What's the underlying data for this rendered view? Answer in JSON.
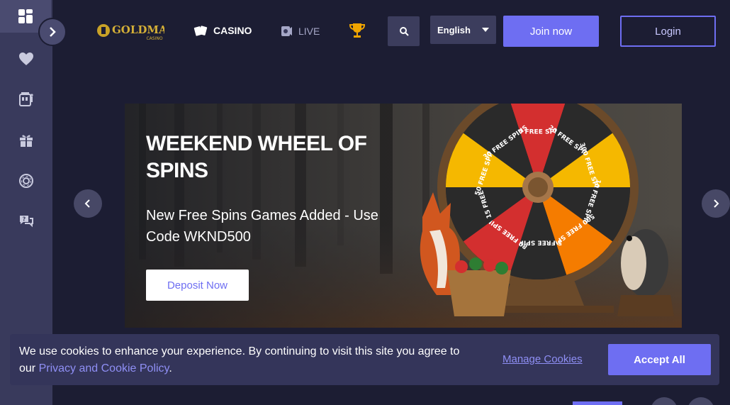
{
  "sidebar": {
    "items": [
      {
        "name": "dashboard-icon"
      },
      {
        "name": "heart-icon"
      },
      {
        "name": "slot-machine-icon"
      },
      {
        "name": "gift-icon"
      },
      {
        "name": "lifebuoy-icon"
      },
      {
        "name": "chat-help-icon"
      }
    ],
    "expand_icon": "chevron-right-icon"
  },
  "header": {
    "logo_text": "GOLDMAN",
    "logo_subtext": "CASINO",
    "nav": [
      {
        "label": "CASINO",
        "icon": "cards-icon"
      },
      {
        "label": "LIVE",
        "icon": "live-dealer-icon"
      }
    ],
    "trophy_icon": "trophy-icon",
    "search_icon": "search-icon",
    "language": "English",
    "join_label": "Join now",
    "login_label": "Login"
  },
  "banner": {
    "title": "WEEKEND WHEEL OF SPINS",
    "subtitle": "New Free Spins Games Added - Use Code WKND500",
    "cta": "Deposit Now",
    "wheel_segments": [
      "100 FREE SPINS",
      "20 FREE SPINS",
      "300 FREE SPINS",
      "10 FREE SPINS",
      "500 FREE SPINS",
      "5 FREE SPINS",
      "80 FREE SPINS",
      "15 FREE",
      "50 FREE SPINS",
      "30 FREE SPINS"
    ]
  },
  "cookie": {
    "text_before": "We use cookies to enhance your experience. By continuing to visit this site you agree to our ",
    "link": "Privacy and Cookie Policy",
    "text_after": ".",
    "manage_label": "Manage Cookies",
    "accept_label": "Accept All"
  },
  "colors": {
    "background": "#1c1d33",
    "sidebar": "#393a5c",
    "accent": "#6e6ef2",
    "cookie_bar": "#34355a"
  }
}
